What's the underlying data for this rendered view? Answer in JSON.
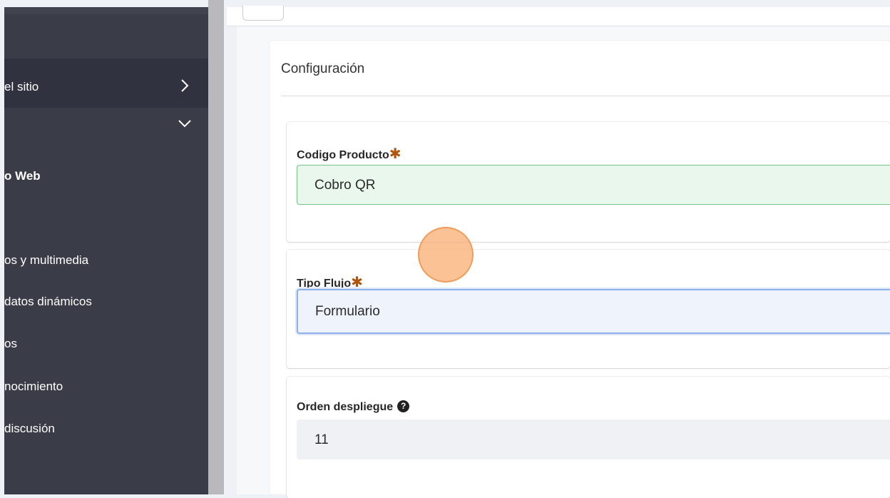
{
  "sidebar": {
    "items": [
      {
        "label": "el sitio",
        "bold": false
      },
      {
        "label": "",
        "bold": false
      },
      {
        "label": "o Web",
        "bold": true
      },
      {
        "label": "os y multimedia",
        "bold": false
      },
      {
        "label": "datos dinámicos",
        "bold": false
      },
      {
        "label": "os",
        "bold": false
      },
      {
        "label": "nocimiento",
        "bold": false
      },
      {
        "label": "discusión",
        "bold": false
      }
    ],
    "icons": [
      "chevron-right-icon",
      "chevron-down-icon"
    ]
  },
  "card": {
    "title": "Configuración"
  },
  "fields": [
    {
      "label": "Codigo Producto",
      "required": true,
      "value": "Cobro QR",
      "state": "valid"
    },
    {
      "label": "Tipo Flujo",
      "required": true,
      "value": "Formulario",
      "state": "focused"
    },
    {
      "label": "Orden despliegue",
      "required": false,
      "help": "?",
      "value": "11",
      "state": "readonly"
    }
  ],
  "required_mark": "✱",
  "colors": {
    "sidebar_bg": "#3a3c48",
    "required": "#b1550a",
    "valid_border": "#74c387",
    "focus_border": "#8fb0e8"
  }
}
